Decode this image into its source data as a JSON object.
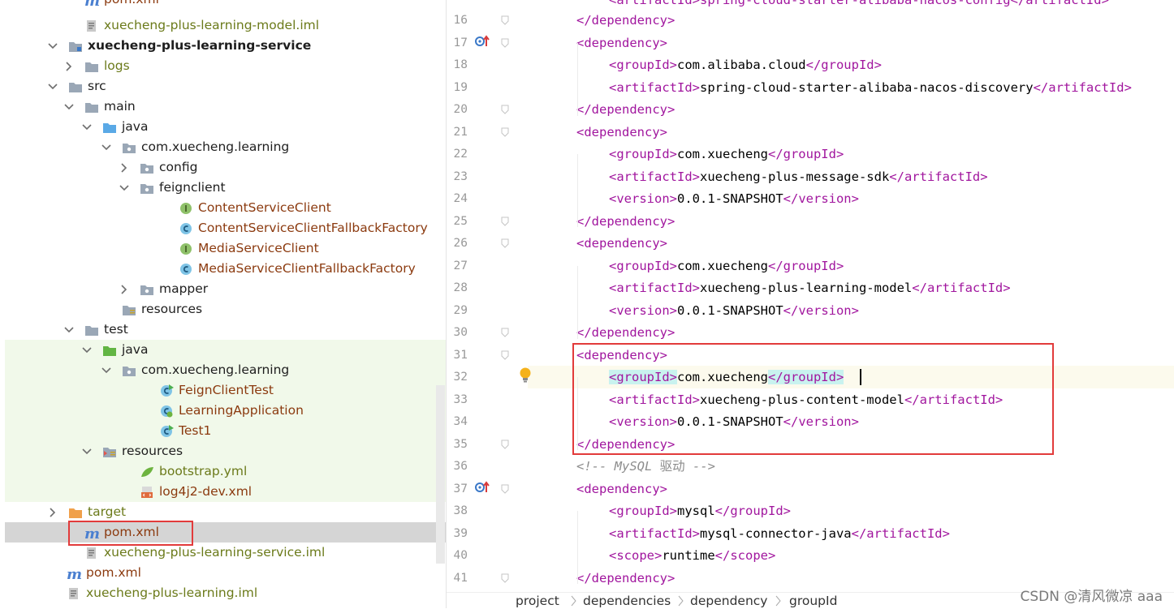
{
  "tree": {
    "rows": [
      {
        "label": "pom.xml",
        "icon": "maven-icon",
        "color": "brown"
      },
      {
        "label": "xuecheng-plus-learning-model.iml",
        "icon": "iml-file-icon",
        "color": "green"
      },
      {
        "label": "xuecheng-plus-learning-service",
        "icon": "module-folder-icon",
        "color": "bold"
      },
      {
        "label": "logs",
        "icon": "folder-icon",
        "color": "green"
      },
      {
        "label": "src",
        "icon": "folder-icon",
        "color": "normal"
      },
      {
        "label": "main",
        "icon": "folder-icon",
        "color": "normal"
      },
      {
        "label": "java",
        "icon": "source-folder-icon",
        "color": "normal"
      },
      {
        "label": "com.xuecheng.learning",
        "icon": "package-icon",
        "color": "normal"
      },
      {
        "label": "config",
        "icon": "package-icon",
        "color": "normal"
      },
      {
        "label": "feignclient",
        "icon": "package-icon",
        "color": "normal"
      },
      {
        "label": "ContentServiceClient",
        "icon": "interface-icon",
        "color": "brown"
      },
      {
        "label": "ContentServiceClientFallbackFactory",
        "icon": "class-icon",
        "color": "brown"
      },
      {
        "label": "MediaServiceClient",
        "icon": "interface-icon",
        "color": "brown"
      },
      {
        "label": "MediaServiceClientFallbackFactory",
        "icon": "class-icon",
        "color": "brown"
      },
      {
        "label": "mapper",
        "icon": "package-icon",
        "color": "normal"
      },
      {
        "label": "resources",
        "icon": "resources-folder-icon",
        "color": "normal"
      },
      {
        "label": "test",
        "icon": "folder-icon",
        "color": "normal"
      },
      {
        "label": "java",
        "icon": "test-folder-icon",
        "color": "normal"
      },
      {
        "label": "com.xuecheng.learning",
        "icon": "package-icon",
        "color": "normal"
      },
      {
        "label": "FeignClientTest",
        "icon": "test-class-icon",
        "color": "brown"
      },
      {
        "label": "LearningApplication",
        "icon": "spring-class-icon",
        "color": "brown"
      },
      {
        "label": "Test1",
        "icon": "test-class-icon",
        "color": "brown"
      },
      {
        "label": "resources",
        "icon": "test-resources-folder-icon",
        "color": "normal"
      },
      {
        "label": "bootstrap.yml",
        "icon": "yaml-file-icon",
        "color": "green"
      },
      {
        "label": "log4j2-dev.xml",
        "icon": "xml-file-icon",
        "color": "brown"
      },
      {
        "label": "target",
        "icon": "excluded-folder-icon",
        "color": "green"
      },
      {
        "label": "pom.xml",
        "icon": "maven-icon",
        "color": "brown"
      },
      {
        "label": "xuecheng-plus-learning-service.iml",
        "icon": "iml-file-icon",
        "color": "green"
      },
      {
        "label": "pom.xml",
        "icon": "maven-icon",
        "color": "brown"
      },
      {
        "label": "xuecheng-plus-learning.iml",
        "icon": "iml-file-icon",
        "color": "green"
      }
    ]
  },
  "editor": {
    "lines": [
      {
        "n": "16",
        "ind": 1,
        "parts": [
          [
            "tag",
            "</dependency>"
          ]
        ]
      },
      {
        "n": "17",
        "ind": 1,
        "parts": [
          [
            "tag",
            "<dependency>"
          ]
        ]
      },
      {
        "n": "18",
        "ind": 2,
        "parts": [
          [
            "tag",
            "<groupId>"
          ],
          [
            "txt",
            "com.alibaba.cloud"
          ],
          [
            "tag",
            "</groupId>"
          ]
        ]
      },
      {
        "n": "19",
        "ind": 2,
        "parts": [
          [
            "tag",
            "<artifactId>"
          ],
          [
            "txt",
            "spring-cloud-starter-alibaba-nacos-discovery"
          ],
          [
            "tag",
            "</artifactId>"
          ]
        ]
      },
      {
        "n": "20",
        "ind": 1,
        "parts": [
          [
            "tag",
            "</dependency>"
          ]
        ]
      },
      {
        "n": "21",
        "ind": 1,
        "parts": [
          [
            "tag",
            "<dependency>"
          ]
        ]
      },
      {
        "n": "22",
        "ind": 2,
        "parts": [
          [
            "tag",
            "<groupId>"
          ],
          [
            "txt",
            "com.xuecheng"
          ],
          [
            "tag",
            "</groupId>"
          ]
        ]
      },
      {
        "n": "23",
        "ind": 2,
        "parts": [
          [
            "tag",
            "<artifactId>"
          ],
          [
            "txt",
            "xuecheng-plus-message-sdk"
          ],
          [
            "tag",
            "</artifactId>"
          ]
        ]
      },
      {
        "n": "24",
        "ind": 2,
        "parts": [
          [
            "tag",
            "<version>"
          ],
          [
            "txt",
            "0.0.1-SNAPSHOT"
          ],
          [
            "tag",
            "</version>"
          ]
        ]
      },
      {
        "n": "25",
        "ind": 1,
        "parts": [
          [
            "tag",
            "</dependency>"
          ]
        ]
      },
      {
        "n": "26",
        "ind": 1,
        "parts": [
          [
            "tag",
            "<dependency>"
          ]
        ]
      },
      {
        "n": "27",
        "ind": 2,
        "parts": [
          [
            "tag",
            "<groupId>"
          ],
          [
            "txt",
            "com.xuecheng"
          ],
          [
            "tag",
            "</groupId>"
          ]
        ]
      },
      {
        "n": "28",
        "ind": 2,
        "parts": [
          [
            "tag",
            "<artifactId>"
          ],
          [
            "txt",
            "xuecheng-plus-learning-model"
          ],
          [
            "tag",
            "</artifactId>"
          ]
        ]
      },
      {
        "n": "29",
        "ind": 2,
        "parts": [
          [
            "tag",
            "<version>"
          ],
          [
            "txt",
            "0.0.1-SNAPSHOT"
          ],
          [
            "tag",
            "</version>"
          ]
        ]
      },
      {
        "n": "30",
        "ind": 1,
        "parts": [
          [
            "tag",
            "</dependency>"
          ]
        ]
      },
      {
        "n": "31",
        "ind": 1,
        "parts": [
          [
            "tag",
            "<dependency>"
          ]
        ]
      },
      {
        "n": "32",
        "ind": 2,
        "parts": [
          [
            "taghl",
            "<groupId>"
          ],
          [
            "txt",
            "com.xuecheng"
          ],
          [
            "taghl",
            "</groupId>"
          ]
        ]
      },
      {
        "n": "33",
        "ind": 2,
        "parts": [
          [
            "tag",
            "<artifactId>"
          ],
          [
            "txt",
            "xuecheng-plus-content-model"
          ],
          [
            "tag",
            "</artifactId>"
          ]
        ]
      },
      {
        "n": "34",
        "ind": 2,
        "parts": [
          [
            "tag",
            "<version>"
          ],
          [
            "txt",
            "0.0.1-SNAPSHOT"
          ],
          [
            "tag",
            "</version>"
          ]
        ]
      },
      {
        "n": "35",
        "ind": 1,
        "parts": [
          [
            "tag",
            "</dependency>"
          ]
        ]
      },
      {
        "n": "36",
        "ind": 1,
        "parts": [
          [
            "cmt",
            "<!-- MySQL "
          ],
          [
            "cmtcn",
            "驱动"
          ],
          [
            "cmt",
            " -->"
          ]
        ]
      },
      {
        "n": "37",
        "ind": 1,
        "parts": [
          [
            "tag",
            "<dependency>"
          ]
        ]
      },
      {
        "n": "38",
        "ind": 2,
        "parts": [
          [
            "tag",
            "<groupId>"
          ],
          [
            "txt",
            "mysql"
          ],
          [
            "tag",
            "</groupId>"
          ]
        ]
      },
      {
        "n": "39",
        "ind": 2,
        "parts": [
          [
            "tag",
            "<artifactId>"
          ],
          [
            "txt",
            "mysql-connector-java"
          ],
          [
            "tag",
            "</artifactId>"
          ]
        ]
      },
      {
        "n": "40",
        "ind": 2,
        "parts": [
          [
            "tag",
            "<scope>"
          ],
          [
            "txt",
            "runtime"
          ],
          [
            "tag",
            "</scope>"
          ]
        ]
      },
      {
        "n": "41",
        "ind": 1,
        "parts": [
          [
            "tag",
            "</dependency>"
          ]
        ]
      }
    ],
    "top_partial": "<artifactId>spring-cloud-starter-alibaba-nacos-config</artifactId>"
  },
  "breadcrumb": [
    "project",
    "dependencies",
    "dependency",
    "groupId"
  ],
  "watermark": "CSDN @清风微凉 aaa",
  "colors": {
    "tag": "#a1169e",
    "highlight_box": "#e23b3b",
    "test_band": "#f1f9ea",
    "selected_row": "#d5d5d5"
  }
}
